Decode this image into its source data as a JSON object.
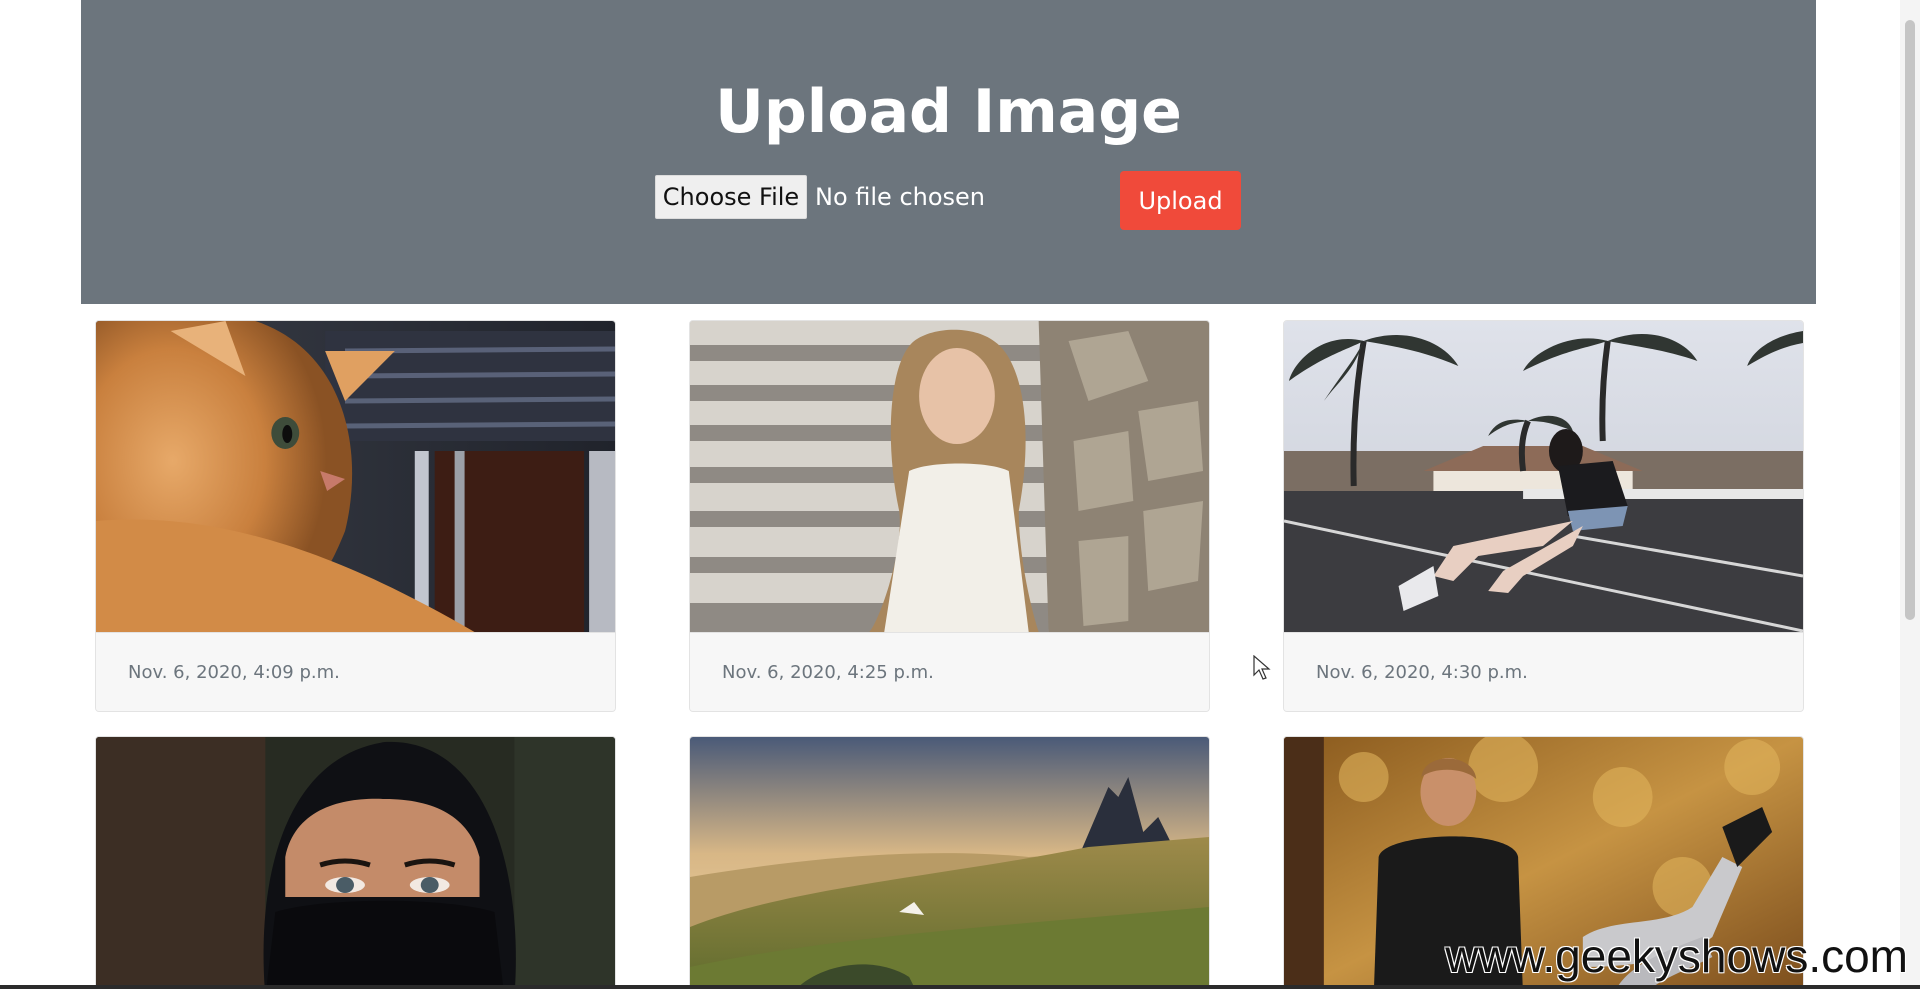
{
  "hero": {
    "title": "Upload Image",
    "choose_file_label": "Choose File",
    "file_status": "No file chosen",
    "upload_label": "Upload",
    "background_color": "#6c757d",
    "upload_color": "#f04a3a"
  },
  "gallery": {
    "items": [
      {
        "image": "orange-cat-photo",
        "date": "Nov. 6, 2020, 4:09 p.m."
      },
      {
        "image": "woman-on-stone-steps-photo",
        "date": "Nov. 6, 2020, 4:25 p.m."
      },
      {
        "image": "roller-skater-palm-trees-photo",
        "date": "Nov. 6, 2020, 4:30 p.m."
      },
      {
        "image": "woman-in-black-niqab-photo"
      },
      {
        "image": "mountain-landscape-sunset-photo"
      },
      {
        "image": "man-sitting-autumn-forest-photo"
      }
    ]
  },
  "watermark": "www.geekyshows.com"
}
